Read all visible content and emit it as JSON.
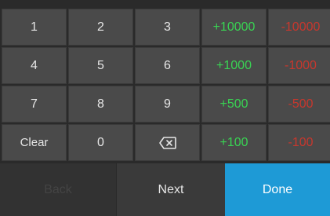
{
  "rows": [
    {
      "keys": [
        {
          "label": "1",
          "kind": "digit"
        },
        {
          "label": "2",
          "kind": "digit"
        },
        {
          "label": "3",
          "kind": "digit"
        },
        {
          "label": "+10000",
          "kind": "plus"
        },
        {
          "label": "-10000",
          "kind": "minus"
        }
      ]
    },
    {
      "keys": [
        {
          "label": "4",
          "kind": "digit"
        },
        {
          "label": "5",
          "kind": "digit"
        },
        {
          "label": "6",
          "kind": "digit"
        },
        {
          "label": "+1000",
          "kind": "plus"
        },
        {
          "label": "-1000",
          "kind": "minus"
        }
      ]
    },
    {
      "keys": [
        {
          "label": "7",
          "kind": "digit"
        },
        {
          "label": "8",
          "kind": "digit"
        },
        {
          "label": "9",
          "kind": "digit"
        },
        {
          "label": "+500",
          "kind": "plus"
        },
        {
          "label": "-500",
          "kind": "minus"
        }
      ]
    },
    {
      "keys": [
        {
          "label": "Clear",
          "kind": "label"
        },
        {
          "label": "0",
          "kind": "digit"
        },
        {
          "label": "",
          "kind": "backspace",
          "icon": "backspace-icon"
        },
        {
          "label": "+100",
          "kind": "plus"
        },
        {
          "label": "-100",
          "kind": "minus"
        }
      ]
    }
  ],
  "bottom": {
    "back_label": "Back",
    "next_label": "Next",
    "done_label": "Done"
  },
  "colors": {
    "plus": "#39d353",
    "minus": "#c8372d",
    "done": "#1e9ad6",
    "key_bg": "#4a4a4a"
  }
}
